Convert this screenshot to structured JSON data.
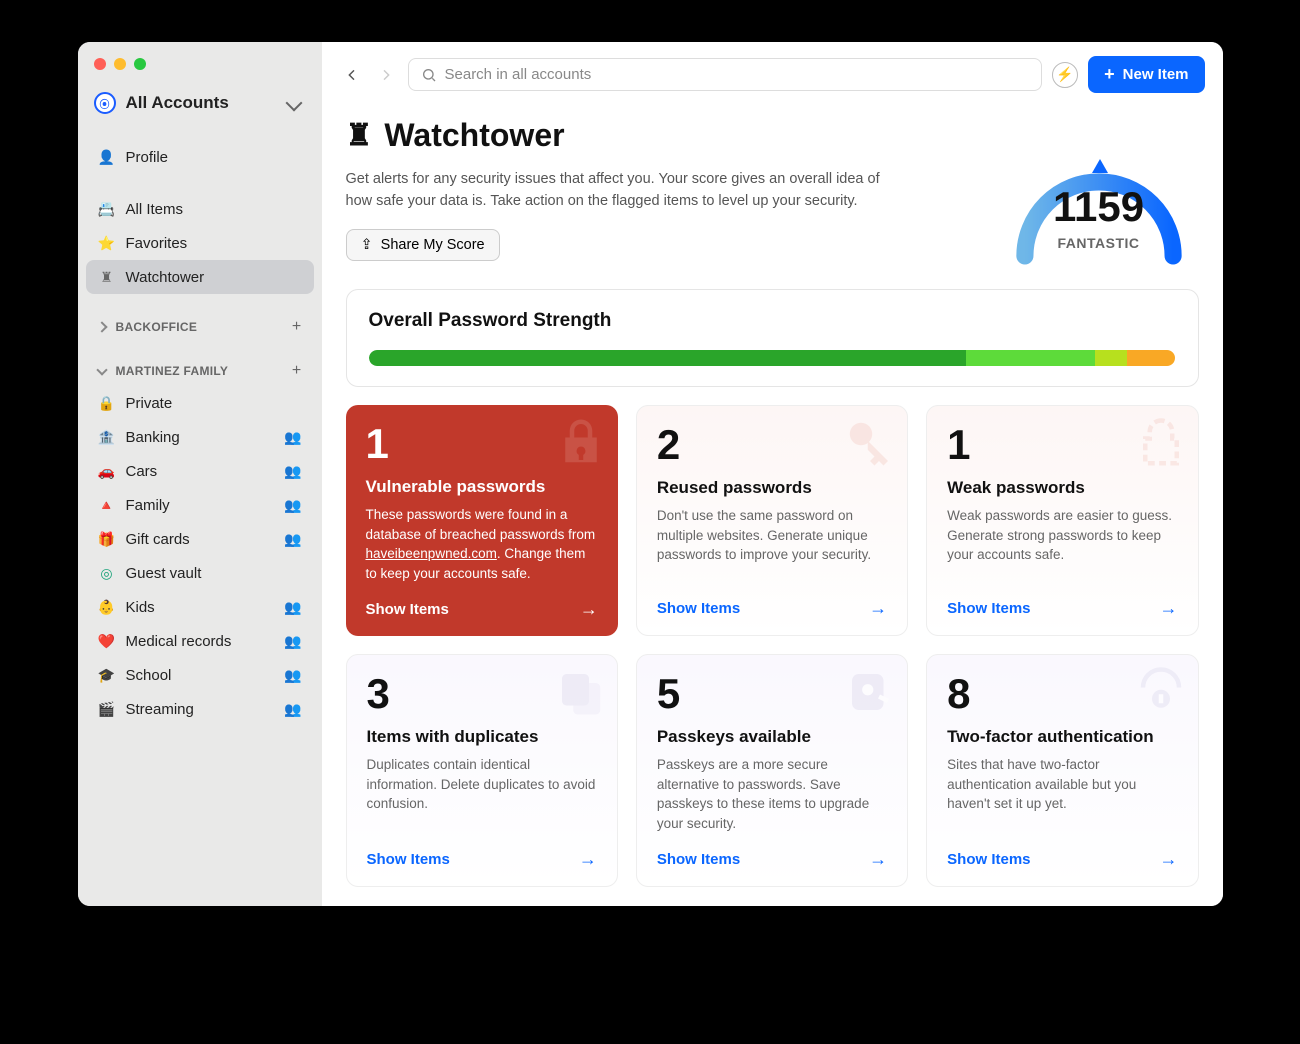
{
  "accounts_label": "All Accounts",
  "sidebar": {
    "profile": "Profile",
    "items": [
      {
        "icon": "📇",
        "label": "All Items"
      },
      {
        "icon": "⭐",
        "label": "Favorites"
      },
      {
        "icon": "♜",
        "label": "Watchtower",
        "active": true
      }
    ],
    "groups": [
      {
        "name": "BACKOFFICE",
        "expanded": false,
        "items": []
      },
      {
        "name": "MARTINEZ FAMILY",
        "expanded": true,
        "items": [
          {
            "icon": "🔒",
            "color": "#888",
            "shared": false,
            "label": "Private"
          },
          {
            "icon": "🏦",
            "color": "#1e6bd6",
            "shared": true,
            "label": "Banking"
          },
          {
            "icon": "🚗",
            "color": "#e24a7a",
            "shared": true,
            "label": "Cars"
          },
          {
            "icon": "🔺",
            "color": "#e07b1f",
            "shared": true,
            "label": "Family"
          },
          {
            "icon": "🎁",
            "color": "#e24a7a",
            "shared": true,
            "label": "Gift cards"
          },
          {
            "icon": "◎",
            "color": "#1aa37a",
            "shared": false,
            "label": "Guest vault"
          },
          {
            "icon": "👶",
            "color": "#6fb53a",
            "shared": true,
            "label": "Kids"
          },
          {
            "icon": "❤️",
            "color": "#e24a7a",
            "shared": true,
            "label": "Medical records"
          },
          {
            "icon": "🎓",
            "color": "#1e8fd6",
            "shared": true,
            "label": "School"
          },
          {
            "icon": "🎬",
            "color": "#2a8a61",
            "shared": true,
            "label": "Streaming"
          }
        ]
      }
    ]
  },
  "search_placeholder": "Search in all accounts",
  "new_item_label": "New Item",
  "page": {
    "title": "Watchtower",
    "description": "Get alerts for any security issues that affect you. Your score gives an overall idea of how safe your data is. Take action on the flagged items to level up your security.",
    "share_label": "Share My Score",
    "score": "1159",
    "score_word": "FANTASTIC"
  },
  "overall": {
    "title": "Overall Password Strength",
    "segments": [
      {
        "color": "#2aa52a",
        "width": 74
      },
      {
        "color": "#5ddb3a",
        "width": 16
      },
      {
        "color": "#b7e01e",
        "width": 4
      },
      {
        "color": "#f9a825",
        "width": 6
      }
    ]
  },
  "tiles": [
    {
      "count": "1",
      "title": "Vulnerable passwords",
      "body": "These passwords were found in a database of breached passwords from ",
      "link_text": "haveibeenpwned.com",
      "body_after": ". Change them to keep your accounts safe.",
      "cta": "Show Items",
      "style": "red",
      "icon_color": "#ffffff40"
    },
    {
      "count": "2",
      "title": "Reused passwords",
      "body": "Don't use the same password on multiple websites. Generate unique passwords to improve your security.",
      "cta": "Show Items",
      "style": "pinkish",
      "icon_color": "#f6d5cf"
    },
    {
      "count": "1",
      "title": "Weak passwords",
      "body": "Weak passwords are easier to guess. Generate strong passwords to keep your accounts safe.",
      "cta": "Show Items",
      "style": "pinkish",
      "icon_color": "#f6d5cf"
    },
    {
      "count": "3",
      "title": "Items with duplicates",
      "body": "Duplicates contain identical information. Delete duplicates to avoid confusion.",
      "cta": "Show Items",
      "style": "purplish",
      "icon_color": "#e2dff0"
    },
    {
      "count": "5",
      "title": "Passkeys available",
      "body": "Passkeys are a more secure alternative to passwords. Save passkeys to these items to upgrade your security.",
      "cta": "Show Items",
      "style": "purplish",
      "icon_color": "#e2dff0"
    },
    {
      "count": "8",
      "title": "Two-factor authentication",
      "body": "Sites that have two-factor authentication available but you haven't set it up yet.",
      "cta": "Show Items",
      "style": "purplish",
      "icon_color": "#e2dff0"
    }
  ]
}
